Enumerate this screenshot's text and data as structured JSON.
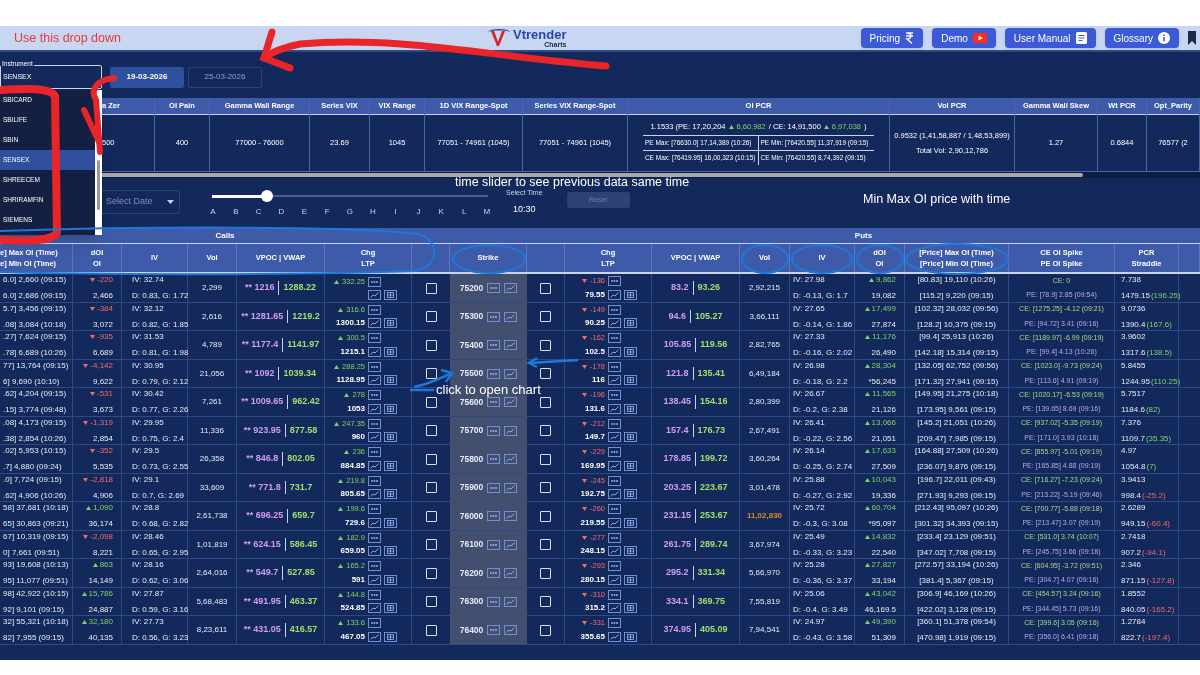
{
  "header": {
    "logo": {
      "name": "Vtrender",
      "sub": "Charts"
    },
    "buttons": [
      {
        "label": "Pricing",
        "kind": "rupee"
      },
      {
        "label": "Demo",
        "kind": "video"
      },
      {
        "label": "User Manual",
        "kind": "document"
      },
      {
        "label": "Glossary",
        "kind": "info"
      }
    ]
  },
  "annotations": [
    {
      "text": "Use this drop down",
      "color": "#e53935"
    },
    {
      "text": "time slider to see previous data same time",
      "color": "#ffffff"
    },
    {
      "text": "Min Max OI price with time",
      "color": "#ffffff"
    },
    {
      "text": "click to open chart",
      "color": "#ffffff"
    }
  ],
  "instrument": {
    "label": "Instrument",
    "value": "SENSEX",
    "options": [
      {
        "label": "SBICARD",
        "selected": false
      },
      {
        "label": "SBILIFE",
        "selected": false
      },
      {
        "label": "SBIN",
        "selected": false
      },
      {
        "label": "SENSEX",
        "selected": true
      },
      {
        "label": "SHREECEM",
        "selected": false
      },
      {
        "label": "SHRIRAMFIN",
        "selected": false
      },
      {
        "label": "SIEMENS",
        "selected": false
      }
    ]
  },
  "expiry_tabs": [
    {
      "label": "19-03-2026",
      "selected": true
    },
    {
      "label": "25-03-2026",
      "selected": false
    }
  ],
  "summary": {
    "columns": [
      {
        "header": "a Zer",
        "kind": "plain",
        "value": "500"
      },
      {
        "header": "OI Pain",
        "kind": "plain",
        "value": "400"
      },
      {
        "header": "Gamma Wall Range",
        "kind": "plain",
        "value": "77000 - 76000"
      },
      {
        "header": "Series VIX",
        "kind": "plain",
        "value": "23.69"
      },
      {
        "header": "VIX Range",
        "kind": "plain",
        "value": "1045"
      },
      {
        "header": "1D VIX Range-Spot",
        "kind": "plain",
        "value": "77051 - 74961 (1045)"
      },
      {
        "header": "Series VIX Range-Spot",
        "kind": "plain",
        "value": "77051 - 74961 (1045)"
      },
      {
        "header": "OI PCR",
        "kind": "oi_pcr"
      },
      {
        "header": "Vol PCR",
        "kind": "vol_pcr"
      },
      {
        "header": "Gamma Wall Skew",
        "kind": "plain",
        "value": "1.27"
      },
      {
        "header": "Wt PCR",
        "kind": "plain",
        "value": "0.6844"
      },
      {
        "header": "Opt_Parity",
        "kind": "plain",
        "value": "76577 (2"
      }
    ],
    "oi_pcr": {
      "lead": "1.1533 (PE: 17,20,204",
      "pe_change": "6,60,982",
      "middle": "/ CE: 14,91,500",
      "ce_change": "6,97,038",
      "tail": ")",
      "extremes": [
        "PE Max: [76630.0] 17,14,389 (10:26)",
        "PE Min: [76420.55] 11,37,919 (09:15)",
        "CE Max: [76419.95] 16,00,323 (10:15)",
        "CE Min: [76420.55] 8,74,392 (09:15)"
      ]
    },
    "vol_pcr": [
      "0.9532 (1,41,58,887 / 1,48,53,899)",
      "Total Vol: 2,90,12,786"
    ]
  },
  "date_select": {
    "placeholder": "Select Date"
  },
  "time_slider": {
    "level": 0.2,
    "labels": [
      "A",
      "B",
      "C",
      "D",
      "E",
      "F",
      "G",
      "H",
      "I",
      "J",
      "K",
      "L",
      "M"
    ],
    "caption": "Select Time",
    "time": "10:30"
  },
  "reset": {
    "label": "Reset",
    "disabled": true
  },
  "table": {
    "groups": [
      "Calls",
      "Puts"
    ],
    "columns": [
      [
        "e] Max OI (Time)",
        "e] Min OI (Time)"
      ],
      [
        "dOI",
        "OI"
      ],
      [
        "IV"
      ],
      [
        "Vol"
      ],
      [
        "VPOC | VWAP"
      ],
      [
        "Chg",
        "LTP"
      ],
      null,
      [
        "Strike"
      ],
      null,
      [
        "Chg",
        "LTP"
      ],
      [
        "VPOC | VWAP"
      ],
      [
        "Vol"
      ],
      [
        "IV"
      ],
      [
        "dOI",
        "OI"
      ],
      [
        "[Price] Max OI (Time)",
        "[Price] Min OI (Time)"
      ],
      [
        "CE OI Spike",
        "PE OI Spike"
      ],
      [
        "PCR",
        "Straddle"
      ],
      null
    ],
    "rows": [
      {
        "strike": "75200",
        "call": {
          "max": "6.0] 2,660 (09:15)",
          "min": "6.0] 2,686 (09:15)",
          "doi": "-220",
          "doi_up": false,
          "oi": "2,466",
          "iv": "IV: 32.74",
          "greeks": "D: 0.83, G: 1.72",
          "vol": "2,299",
          "vpoc": "** 1216",
          "vwap": "1288.22",
          "chg": "332.25",
          "chg_up": true,
          "checked": false
        },
        "put": {
          "chg": "-136",
          "chg_up": false,
          "ltp": "79.55",
          "vpoc": "83.2",
          "vwap": "93.26",
          "vol": "2,92,215",
          "vol_high": false,
          "iv": "IV: 27.98",
          "greeks": "D: -0.13, G: 1.7",
          "doi": "9,862",
          "doi_up": true,
          "oi": "19,082",
          "max": "[80.83] 19,110 (10:26)",
          "min": "[115.2] 9,220 (09:15)",
          "checked": false
        },
        "spike_ce": "CE: 0",
        "spike_pe": "PE: [78.9] 2.85 (09:54)",
        "pcr": "7.738",
        "straddle": "1479.15",
        "straddle_chg": "(196.25)",
        "straddle_up": true
      },
      {
        "strike": "75300",
        "call": {
          "max": "5.7] 3,456 (09:15)",
          "min": ".08] 3,084 (10:18)",
          "doi": "-384",
          "doi_up": false,
          "oi": "3,072",
          "iv": "IV: 32.12",
          "greeks": "D: 0.82, G: 1.85",
          "vol": "2,616",
          "vpoc": "** 1281.65",
          "vwap": "1219.2",
          "chg": "316.6",
          "chg_up": true,
          "ltp": "1300.15",
          "checked": false
        },
        "put": {
          "chg": "-149",
          "chg_up": false,
          "ltp": "90.25",
          "vpoc": "94.6",
          "vwap": "105.27",
          "vol": "3,66,111",
          "vol_high": false,
          "iv": "IV: 27.65",
          "greeks": "D: -0.14, G: 1.86",
          "doi": "17,499",
          "doi_up": true,
          "oi": "27,874",
          "max": "[102.32] 28,032 (09:56)",
          "min": "[128.2] 10,375 (09:15)",
          "checked": false
        },
        "spike_ce": "CE: [1275.25] -4.12 (09:21)",
        "spike_pe": "PE: [94.72] 3.41 (09:16)",
        "pcr": "9.0736",
        "straddle": "1390.4",
        "straddle_chg": "(167.6)",
        "straddle_up": true
      },
      {
        "strike": "75400",
        "call": {
          "max": ".27] 7,624 (09:15)",
          "min": ".78] 6,689 (10:26)",
          "doi": "-935",
          "doi_up": false,
          "oi": "6,689",
          "iv": "IV: 31.53",
          "greeks": "D: 0.81, G: 1.98",
          "vol": "4,789",
          "vpoc": "** 1177.4",
          "vwap": "1141.97",
          "chg": "300.5",
          "chg_up": true,
          "ltp": "1215.1",
          "checked": false
        },
        "put": {
          "chg": "-162",
          "chg_up": false,
          "ltp": "102.5",
          "vpoc": "105.85",
          "vwap": "119.56",
          "vol": "2,82,765",
          "vol_high": false,
          "iv": "IV: 27.33",
          "greeks": "D: -0.16, G: 2.02",
          "doi": "11,176",
          "doi_up": true,
          "oi": "26,490",
          "max": "[99.4] 25,913 (10:26)",
          "min": "[142.18] 15,314 (09:15)",
          "checked": false
        },
        "spike_ce": "CE: [1189.97] -6.99 (09:19)",
        "spike_pe": "PE: [99.4] 4.13 (10:26)",
        "pcr": "3.9602",
        "straddle": "1317.6",
        "straddle_chg": "(138.5)",
        "straddle_up": true
      },
      {
        "strike": "75500",
        "call": {
          "max": "77] 13,764 (09:15)",
          "min": "6] 9,690 (10:10)",
          "doi": "-4,142",
          "doi_up": false,
          "oi": "9,622",
          "iv": "IV: 30.95",
          "greeks": "D: 0.79, G: 2.12",
          "vol": "21,056",
          "vpoc": "** 1092",
          "vwap": "1039.34",
          "chg": "288.25",
          "chg_up": true,
          "ltp": "1128.95",
          "checked": false
        },
        "put": {
          "chg": "-178",
          "chg_up": false,
          "ltp": "116",
          "vpoc": "121.8",
          "vwap": "135.41",
          "vol": "6,49,184",
          "vol_high": false,
          "iv": "IV: 26.98",
          "greeks": "D: -0.18, G: 2.2",
          "doi": "28,304",
          "doi_up": true,
          "oi": "*56,245",
          "max": "[132.05] 62,752 (09:56)",
          "min": "[171.32] 27,941 (09:15)",
          "checked": false
        },
        "spike_ce": "CE: [1023.0] -9.73 (09:24)",
        "spike_pe": "PE: [113.6] 4.91 (09:19)",
        "pcr": "5.8455",
        "straddle": "1244.95",
        "straddle_chg": "(110.25)",
        "straddle_up": true
      },
      {
        "strike": "75600",
        "call": {
          "max": ".62] 4,204 (09:15)",
          "min": ".15] 3,774 (09:48)",
          "doi": "-531",
          "doi_up": false,
          "oi": "3,673",
          "iv": "IV: 30.42",
          "greeks": "D: 0.77, G: 2.26",
          "vol": "7,261",
          "vpoc": "** 1009.65",
          "vwap": "962.42",
          "chg": "278",
          "chg_up": true,
          "ltp": "1053",
          "checked": false
        },
        "put": {
          "chg": "-196",
          "chg_up": false,
          "ltp": "131.6",
          "vpoc": "138.45",
          "vwap": "154.16",
          "vol": "2,80,399",
          "vol_high": false,
          "iv": "IV: 26.67",
          "greeks": "D: -0.2, G: 2.38",
          "doi": "11,565",
          "doi_up": true,
          "oi": "21,126",
          "max": "[149.95] 21,275 (10:18)",
          "min": "[173.95] 9,561 (09:15)",
          "checked": false
        },
        "spike_ce": "CE: [1020.17] -6.53 (09:19)",
        "spike_pe": "PE: [139.65] 8.69 (09:16)",
        "pcr": "5.7517",
        "straddle": "1184.6",
        "straddle_chg": "(82)",
        "straddle_up": true
      },
      {
        "strike": "75700",
        "call": {
          "max": ".08] 4,173 (09:15)",
          "min": ".38] 2,854 (10:26)",
          "doi": "-1,319",
          "doi_up": false,
          "oi": "2,854",
          "iv": "IV: 29.95",
          "greeks": "D: 0.75, G: 2.4",
          "vol": "11,336",
          "vpoc": "** 923.95",
          "vwap": "877.58",
          "chg": "247.35",
          "chg_up": true,
          "ltp": "960",
          "checked": false
        },
        "put": {
          "chg": "-212",
          "chg_up": false,
          "ltp": "149.7",
          "vpoc": "157.4",
          "vwap": "176.73",
          "vol": "2,67,491",
          "vol_high": false,
          "iv": "IV: 26.41",
          "greeks": "D: -0.22, G: 2.56",
          "doi": "13,066",
          "doi_up": true,
          "oi": "21,051",
          "max": "[145.2] 21,051 (10:26)",
          "min": "[209.47] 7,985 (09:15)",
          "checked": false
        },
        "spike_ce": "CE: [937.02] -5.35 (09:19)",
        "spike_pe": "PE: [171.0] 3.93 (10:18)",
        "pcr": "7.376",
        "straddle": "1109.7",
        "straddle_chg": "(35.35)",
        "straddle_up": true
      },
      {
        "strike": "75800",
        "call": {
          "max": ".02] 5,953 (10:15)",
          "min": ".7] 4,880 (09:24)",
          "doi": "-352",
          "doi_up": false,
          "oi": "5,535",
          "iv": "IV: 29.5",
          "greeks": "D: 0.73, G: 2.55",
          "vol": "26,358",
          "vpoc": "** 846.8",
          "vwap": "802.05",
          "chg": "236",
          "chg_up": true,
          "ltp": "884.85",
          "checked": false
        },
        "put": {
          "chg": "-229",
          "chg_up": false,
          "ltp": "169.95",
          "vpoc": "178.85",
          "vwap": "199.72",
          "vol": "3,60,264",
          "vol_high": false,
          "iv": "IV: 26.14",
          "greeks": "D: -0.25, G: 2.74",
          "doi": "17,633",
          "doi_up": true,
          "oi": "27,509",
          "max": "[164.88] 27,509 (10:26)",
          "min": "[236.07] 9,876 (09:15)",
          "checked": false
        },
        "spike_ce": "CE: [855.97] -5.01 (09:19)",
        "spike_pe": "PE: [165.85] 4.88 (09:19)",
        "pcr": "4.97",
        "straddle": "1054.8",
        "straddle_chg": "(7)",
        "straddle_up": true
      },
      {
        "strike": "75900",
        "call": {
          "max": ".0] 7,724 (09:15)",
          "min": ".62] 4,906 (10:26)",
          "doi": "-2,818",
          "doi_up": false,
          "oi": "4,906",
          "iv": "IV: 29.1",
          "greeks": "D: 0.7, G: 2.69",
          "vol": "33,609",
          "vpoc": "** 771.8",
          "vwap": "731.7",
          "chg": "219.8",
          "chg_up": true,
          "ltp": "805.65",
          "checked": false
        },
        "put": {
          "chg": "-245",
          "chg_up": false,
          "ltp": "192.75",
          "vpoc": "203.25",
          "vwap": "223.67",
          "vol": "3,01,478",
          "vol_high": false,
          "iv": "IV: 25.88",
          "greeks": "D: -0.27, G: 2.92",
          "doi": "10,043",
          "doi_up": true,
          "oi": "19,336",
          "max": "[196.7] 22,011 (09:43)",
          "min": "[271.93] 9,293 (09:15)",
          "checked": false
        },
        "spike_ce": "CE: [716.27] -7.23 (09:24)",
        "spike_pe": "PE: [213.22] -5.19 (09:46)",
        "pcr": "3.9413",
        "straddle": "998.4",
        "straddle_chg": "(-25.2)",
        "straddle_up": false
      },
      {
        "strike": "76000",
        "call": {
          "max": "58] 37,681 (10:18)",
          "min": "65] 30,863 (09:21)",
          "doi": "1,090",
          "doi_up": true,
          "oi": "36,174",
          "iv": "IV: 28.8",
          "greeks": "D: 0.68, G: 2.82",
          "vol": "2,61,738",
          "vpoc": "** 696.25",
          "vwap": "659.7",
          "chg": "199.6",
          "chg_up": true,
          "ltp": "729.6",
          "checked": false
        },
        "put": {
          "chg": "-260",
          "chg_up": false,
          "ltp": "219.55",
          "vpoc": "231.15",
          "vwap": "253.67",
          "vol": "11,02,830",
          "vol_high": true,
          "iv": "IV: 25.72",
          "greeks": "D: -0.3, G: 3.08",
          "doi": "60,704",
          "doi_up": true,
          "oi": "*95,097",
          "max": "[212.43] 95,097 (10:26)",
          "min": "[301.32] 34,393 (09:15)",
          "checked": false
        },
        "spike_ce": "CE: [700.77] -5.88 (09:18)",
        "spike_pe": "PE: [213.47] 3.07 (09:19)",
        "pcr": "2.6289",
        "straddle": "949.15",
        "straddle_chg": "(-60.4)",
        "straddle_up": false
      },
      {
        "strike": "76100",
        "call": {
          "max": "67] 10,319 (09:15)",
          "min": "0] 7,661 (09:51)",
          "doi": "-2,098",
          "doi_up": false,
          "oi": "8,221",
          "iv": "IV: 28.46",
          "greeks": "D: 0.65, G: 2.95",
          "vol": "1,01,819",
          "vpoc": "** 624.15",
          "vwap": "586.45",
          "chg": "182.9",
          "chg_up": true,
          "ltp": "659.05",
          "checked": false
        },
        "put": {
          "chg": "-277",
          "chg_up": false,
          "ltp": "248.15",
          "vpoc": "261.75",
          "vwap": "289.74",
          "vol": "3,67,974",
          "vol_high": false,
          "iv": "IV: 25.49",
          "greeks": "D: -0.33, G: 3.23",
          "doi": "14,832",
          "doi_up": true,
          "oi": "22,540",
          "max": "[233.4] 23,129 (09:51)",
          "min": "[347.02] 7,708 (09:15)",
          "checked": false
        },
        "spike_ce": "CE: [531.0] 3.74 (10:07)",
        "spike_pe": "PE: [245.75] 3.66 (09:18)",
        "pcr": "2.7418",
        "straddle": "907.2",
        "straddle_chg": "(-94.1)",
        "straddle_up": false
      },
      {
        "strike": "76200",
        "call": {
          "max": "93] 19,608 (10:13)",
          "min": "95] 11,077 (09:51)",
          "doi": "863",
          "doi_up": true,
          "oi": "14,149",
          "iv": "IV: 28.16",
          "greeks": "D: 0.62, G: 3.06",
          "vol": "2,64,016",
          "vpoc": "** 549.7",
          "vwap": "527.85",
          "chg": "165.2",
          "chg_up": true,
          "ltp": "591",
          "checked": false
        },
        "put": {
          "chg": "-293",
          "chg_up": false,
          "ltp": "280.15",
          "vpoc": "295.2",
          "vwap": "331.34",
          "vol": "5,66,970",
          "vol_high": false,
          "iv": "IV: 25.28",
          "greeks": "D: -0.36, G: 3.37",
          "doi": "27,827",
          "doi_up": true,
          "oi": "33,194",
          "max": "[272.57] 33,194 (10:26)",
          "min": "[381.4] 5,367 (09:15)",
          "checked": false
        },
        "spike_ce": "CE: [604.95] -3.72 (09:51)",
        "spike_pe": "PE: [304.7] 4.07 (09:16)",
        "pcr": "2.346",
        "straddle": "871.15",
        "straddle_chg": "(-127.8)",
        "straddle_up": false
      },
      {
        "strike": "76300",
        "call": {
          "max": "98] 42,922 (10:15)",
          "min": "92] 9,101 (09:15)",
          "doi": "15,786",
          "doi_up": true,
          "oi": "24,887",
          "iv": "IV: 27.87",
          "greeks": "D: 0.59, G: 3.16",
          "vol": "5,68,483",
          "vpoc": "** 491.95",
          "vwap": "463.37",
          "chg": "144.8",
          "chg_up": true,
          "ltp": "524.85",
          "checked": false
        },
        "put": {
          "chg": "-310",
          "chg_up": false,
          "ltp": "315.2",
          "vpoc": "334.1",
          "vwap": "369.75",
          "vol": "7,55,819",
          "vol_high": false,
          "iv": "IV: 25.06",
          "greeks": "D: -0.4, G: 3.49",
          "doi": "43,042",
          "doi_up": true,
          "oi": "46,169.5",
          "max": "[306.9] 46,169 (10:26)",
          "min": "[422.02] 3,128 (09:15)",
          "checked": false
        },
        "spike_ce": "CE: [454.57] 3.24 (09:16)",
        "spike_pe": "PE: [344.45] 5.73 (09:16)",
        "pcr": "1.8552",
        "straddle": "840.05",
        "straddle_chg": "(-165.2)",
        "straddle_up": false
      },
      {
        "strike": "76400",
        "call": {
          "max": "32] 55,321 (10:18)",
          "min": "82] 7,955 (09:15)",
          "doi": "32,180",
          "doi_up": true,
          "oi": "40,135",
          "iv": "IV: 27.73",
          "greeks": "D: 0.56, G: 3.23",
          "vol": "8,23,611",
          "vpoc": "** 431.05",
          "vwap": "416.57",
          "chg": "133.6",
          "chg_up": true,
          "ltp": "467.05",
          "checked": false
        },
        "put": {
          "chg": "-331",
          "chg_up": false,
          "ltp": "355.65",
          "vpoc": "374.95",
          "vwap": "405.09",
          "vol": "7,94,541",
          "vol_high": false,
          "iv": "IV: 24.97",
          "greeks": "D: -0.43, G: 3.58",
          "doi": "49,390",
          "doi_up": true,
          "oi": "51,309",
          "max": "[360.1] 51,378 (09:54)",
          "min": "[470.98] 1,919 (09:15)",
          "checked": false
        },
        "spike_ce": "CE: [399.6] 3.05 (09:16)",
        "spike_pe": "PE: [356.0] 6.41 (09:18)",
        "pcr": "1.2784",
        "straddle": "822.7",
        "straddle_chg": "(-197.4)",
        "straddle_up": false
      }
    ]
  }
}
